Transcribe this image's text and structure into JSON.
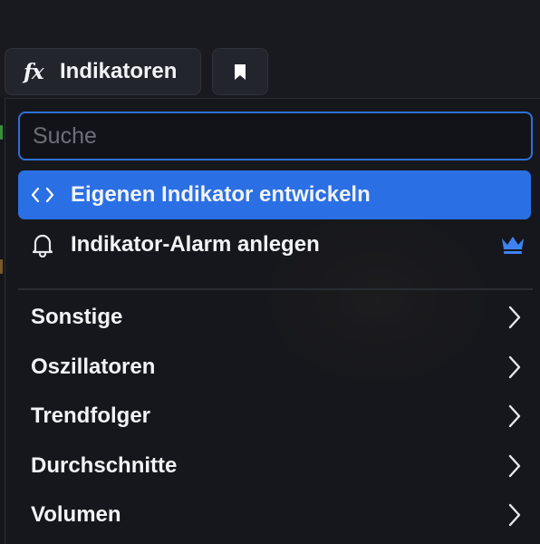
{
  "toolbar": {
    "indicators_label": "Indikatoren",
    "indicators_icon": "fx-icon",
    "bookmark_icon": "bookmark-icon"
  },
  "menu": {
    "search": {
      "placeholder": "Suche",
      "value": ""
    },
    "actions": [
      {
        "label": "Eigenen Indikator entwickeln",
        "icon": "code-brackets-icon",
        "active": true
      },
      {
        "label": "Indikator-Alarm anlegen",
        "icon": "bell-icon",
        "premium": true,
        "premium_icon": "crown-icon"
      }
    ],
    "categories": [
      {
        "label": "Sonstige"
      },
      {
        "label": "Oszillatoren"
      },
      {
        "label": "Trendfolger"
      },
      {
        "label": "Durchschnitte"
      },
      {
        "label": "Volumen"
      }
    ]
  },
  "colors": {
    "accent": "#2a6fe4",
    "search_border": "#2e6fd8",
    "crown": "#3d82f0",
    "background": "#16171c",
    "text": "#f2f3f6"
  }
}
